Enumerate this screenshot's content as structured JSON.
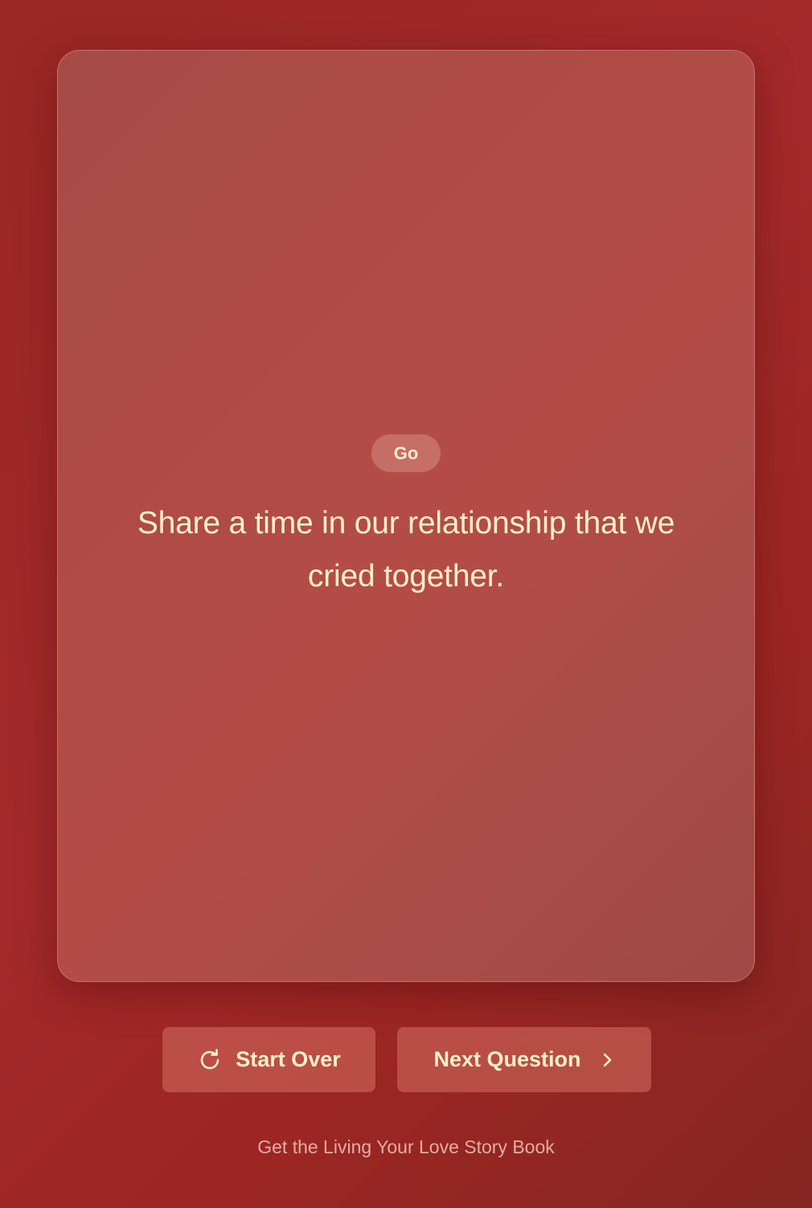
{
  "card": {
    "badge_label": "Go",
    "question_text": "Share a time in our relationship that we cried together."
  },
  "controls": {
    "start_over_label": "Start Over",
    "start_over_icon": "refresh-icon",
    "next_label": "Next Question",
    "next_icon": "chevron-right-icon"
  },
  "footer": {
    "link_text": "Get the Living Your Love Story Book"
  },
  "colors": {
    "background": "#a4292a",
    "card": "#b04b46",
    "text_accent": "#fdf0c8"
  }
}
